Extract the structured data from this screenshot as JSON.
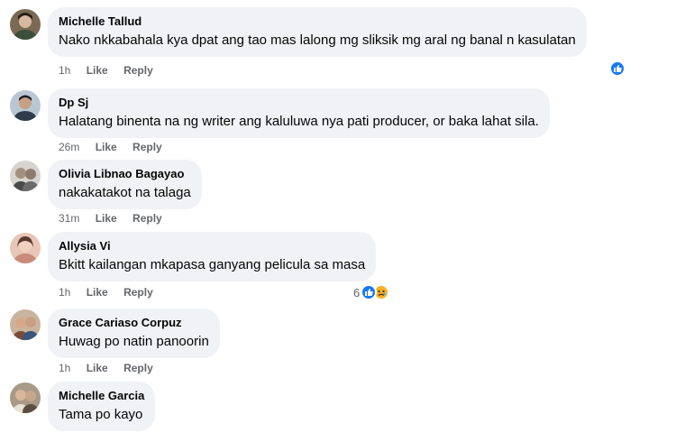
{
  "comments": [
    {
      "author": "Michelle Tallud",
      "text": "Nako nkkabahala kya dpat ang tao mas lalong mg sliksik mg aral ng banal n kasulatan",
      "time": "1h",
      "like": "Like",
      "reply": "Reply"
    },
    {
      "author": "Dp Sj",
      "text": "Halatang binenta na ng writer ang kaluluwa nya pati producer, or baka lahat sila.",
      "time": "26m",
      "like": "Like",
      "reply": "Reply"
    },
    {
      "author": "Olivia Libnao Bagayao",
      "text": "nakakatakot na talaga",
      "time": "31m",
      "like": "Like",
      "reply": "Reply"
    },
    {
      "author": "Allysia Vi",
      "text": "Bkitt kailangan mkapasa ganyang pelicula sa masa",
      "time": "1h",
      "like": "Like",
      "reply": "Reply",
      "reaction_count": "6"
    },
    {
      "author": "Grace Cariaso Corpuz",
      "text": "Huwag po natin panoorin",
      "time": "1h",
      "like": "Like",
      "reply": "Reply"
    },
    {
      "author": "Michelle Garcia",
      "text": "Tama po kayo"
    }
  ],
  "colors": {
    "like_blue": "#1877f2",
    "bubble_gray": "#f0f2f5",
    "sad_yellow": "#f7b125"
  },
  "icons": {
    "like": "thumbs-up-icon",
    "sad": "sad-face-icon"
  }
}
